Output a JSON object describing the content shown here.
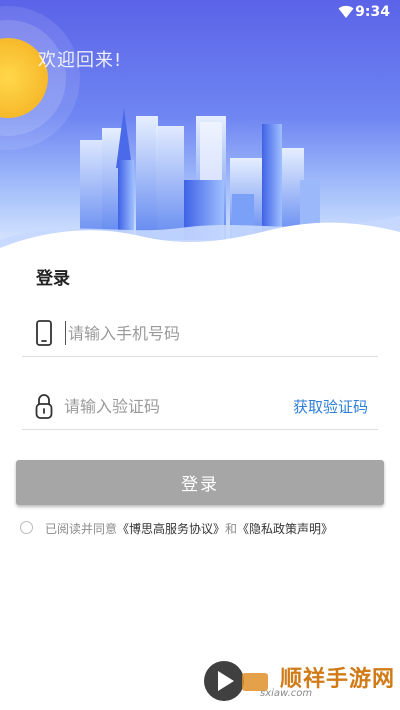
{
  "status_bar": {
    "time": "9:34"
  },
  "header": {
    "welcome": "欢迎回来!"
  },
  "login": {
    "title": "登录",
    "phone_placeholder": "请输入手机号码",
    "code_placeholder": "请输入验证码",
    "get_code": "获取验证码",
    "submit": "登录"
  },
  "agreement": {
    "prefix": "已阅读并同意",
    "service_link": "《博思高服务协议》",
    "conjunction": "和",
    "privacy_link": "《隐私政策声明》"
  },
  "watermark": {
    "brand": "顺祥手游网",
    "site": "sxiaw.com"
  },
  "colors": {
    "accent": "#2f7fd6",
    "button_disabled": "#a6a6a6",
    "header_top": "#5b63e8"
  }
}
